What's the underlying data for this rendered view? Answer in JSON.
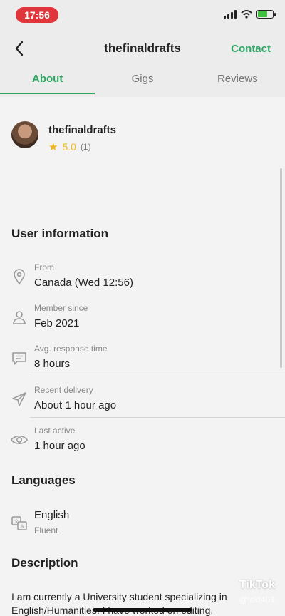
{
  "status_bar": {
    "time": "17:56"
  },
  "header": {
    "title": "thefinaldrafts",
    "contact_label": "Contact"
  },
  "tabs": [
    {
      "label": "About",
      "active": true
    },
    {
      "label": "Gigs",
      "active": false
    },
    {
      "label": "Reviews",
      "active": false
    }
  ],
  "profile": {
    "username": "thefinaldrafts",
    "rating": "5.0",
    "review_count": "(1)"
  },
  "user_info": {
    "title": "User information",
    "rows": [
      {
        "label": "From",
        "value": "Canada (Wed 12:56)",
        "icon": "location-pin-icon"
      },
      {
        "label": "Member since",
        "value": "Feb 2021",
        "icon": "person-icon"
      },
      {
        "label": "Avg. response time",
        "value": "8 hours",
        "icon": "chat-bubble-icon"
      },
      {
        "label": "Recent delivery",
        "value": "About 1 hour ago",
        "icon": "paper-plane-icon"
      },
      {
        "label": "Last active",
        "value": "1 hour ago",
        "icon": "eye-icon"
      }
    ]
  },
  "languages": {
    "title": "Languages",
    "items": [
      {
        "name": "English",
        "level": "Fluent",
        "icon": "translate-icon"
      }
    ]
  },
  "description": {
    "title": "Description",
    "text": "I am currently a University student specializing in English/Humanities. I have worked on editing,"
  },
  "overlay": {
    "watermark": "TikTok",
    "user": "@jskt401"
  },
  "colors": {
    "accent": "#2ea763",
    "star": "#f2b41c",
    "time_pill": "#e0353b"
  }
}
